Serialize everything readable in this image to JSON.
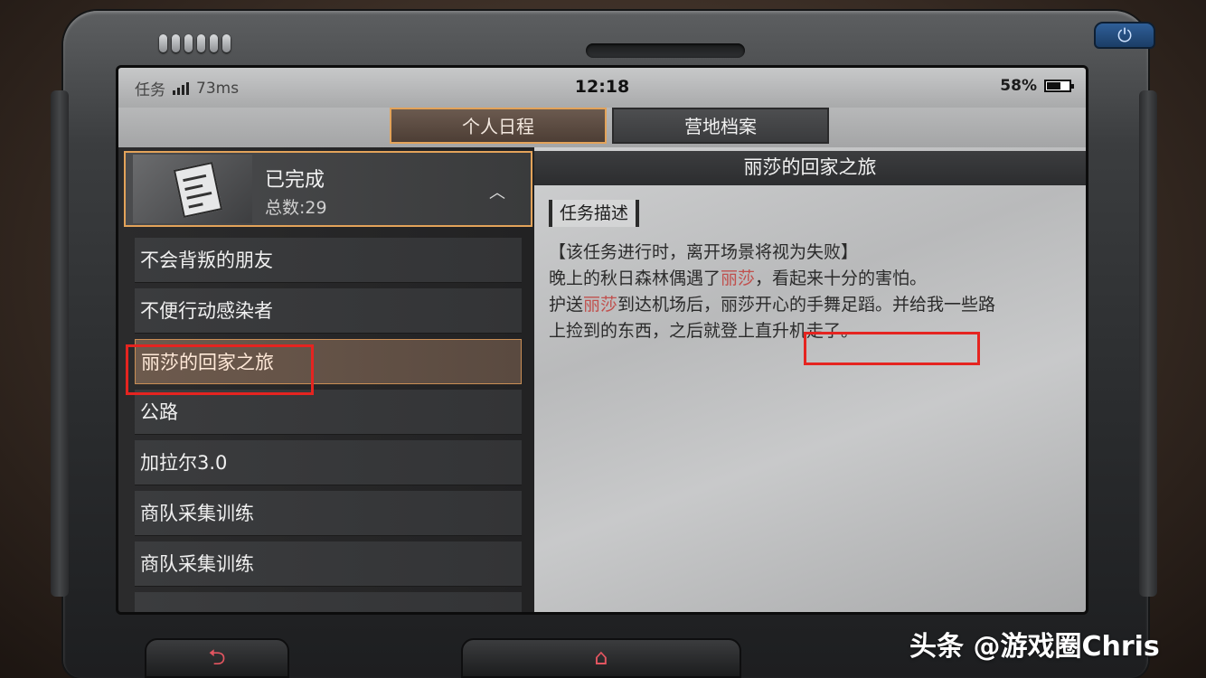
{
  "status_bar": {
    "app_label": "任务",
    "ping": "73ms",
    "time": "12:18",
    "battery": "58%"
  },
  "tabs": [
    {
      "label": "个人日程",
      "active": true
    },
    {
      "label": "营地档案",
      "active": false
    }
  ],
  "group": {
    "title": "已完成",
    "count": "总数:29"
  },
  "quests": [
    {
      "label": "不会背叛的朋友"
    },
    {
      "label": "不便行动感染者"
    },
    {
      "label": "丽莎的回家之旅",
      "selected": true
    },
    {
      "label": "公路"
    },
    {
      "label": "加拉尔3.0"
    },
    {
      "label": "商队采集训练"
    },
    {
      "label": "商队采集训练"
    }
  ],
  "detail": {
    "title": "丽莎的回家之旅",
    "section_label": "任务描述",
    "line1": "【该任务进行时，离开场景将视为失败】",
    "line2_a": "晚上的秋日森林偶遇了",
    "line2_name": "丽莎",
    "line2_b": "，",
    "line2_c": "看起来十分的害怕。",
    "line3_a": "护送",
    "line3_name": "丽莎",
    "line3_b": "到达机场后，丽莎开心的手舞足蹈。并给我一些路",
    "line4": "上捡到的东西，之后就登上直升机走了。"
  },
  "icons": {
    "back": "back-arrow-icon",
    "home": "home-icon",
    "power": "power-icon"
  },
  "colors": {
    "accent_border": "#e3a35a",
    "highlight_name": "#c0504d",
    "annotation_red": "#e52420"
  },
  "watermark": "头条 @游戏圈Chris"
}
